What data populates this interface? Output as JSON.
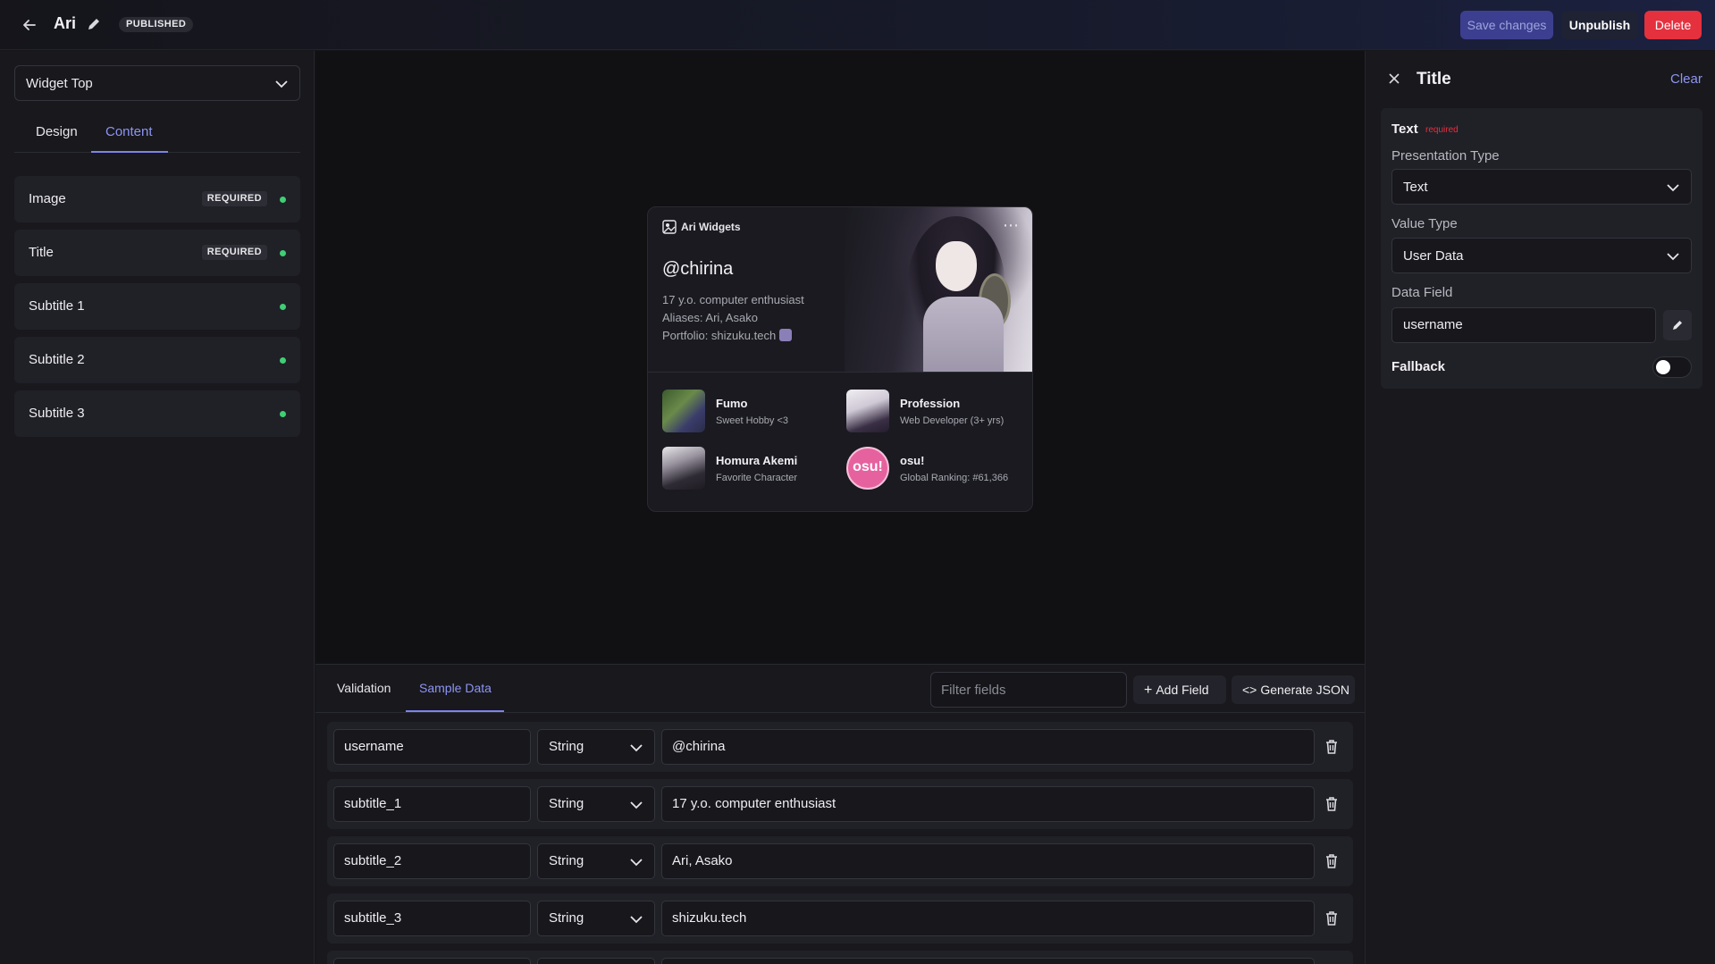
{
  "header": {
    "title": "Ari",
    "status_badge": "PUBLISHED",
    "save_label": "Save changes",
    "unpublish_label": "Unpublish",
    "delete_label": "Delete",
    "colors": {
      "save_bg": "#3c3f8f",
      "delete_bg": "#e5303e",
      "accent": "#8d95f2"
    }
  },
  "sidebar": {
    "widget_select": "Widget Top",
    "tabs": [
      {
        "label": "Design"
      },
      {
        "label": "Content",
        "active": true
      }
    ],
    "fields": [
      {
        "label": "Image",
        "badge": "REQUIRED"
      },
      {
        "label": "Title",
        "badge": "REQUIRED"
      },
      {
        "label": "Subtitle 1",
        "badge": ""
      },
      {
        "label": "Subtitle 2",
        "badge": ""
      },
      {
        "label": "Subtitle 3",
        "badge": ""
      }
    ]
  },
  "card": {
    "brand": "Ari Widgets",
    "menu": "⋯",
    "handle": "@chirina",
    "subtitle_1": "17 y.o. computer enthusiast",
    "subtitle_2": "Aliases: Ari, Asako",
    "subtitle_3": "Portfolio: shizuku.tech",
    "stats": [
      {
        "title": "Fumo",
        "desc": "Sweet Hobby <3"
      },
      {
        "title": "Profession",
        "desc": "Web Developer (3+ yrs)"
      },
      {
        "title": "Homura Akemi",
        "desc": "Favorite Character"
      },
      {
        "title": "osu!",
        "desc": "Global Ranking: #61,366",
        "avatar_text": "osu!"
      }
    ]
  },
  "bottom": {
    "tabs": [
      {
        "label": "Validation"
      },
      {
        "label": "Sample Data",
        "active": true
      }
    ],
    "filter_placeholder": "Filter fields",
    "add_field_label": "Add Field",
    "generate_json_label": "Generate JSON",
    "rows": [
      {
        "key": "username",
        "type": "String",
        "value": "@chirina"
      },
      {
        "key": "subtitle_1",
        "type": "String",
        "value": "17 y.o. computer enthusiast"
      },
      {
        "key": "subtitle_2",
        "type": "String",
        "value": "Ari, Asako"
      },
      {
        "key": "subtitle_3",
        "type": "String",
        "value": "shizuku.tech"
      }
    ]
  },
  "right_panel": {
    "title": "Title",
    "clear_label": "Clear",
    "text_label": "Text",
    "required_label": "required",
    "presentation_type_label": "Presentation Type",
    "presentation_type_value": "Text",
    "value_type_label": "Value Type",
    "value_type_value": "User Data",
    "data_field_label": "Data Field",
    "data_field_value": "username",
    "fallback_label": "Fallback",
    "fallback_enabled": false
  }
}
